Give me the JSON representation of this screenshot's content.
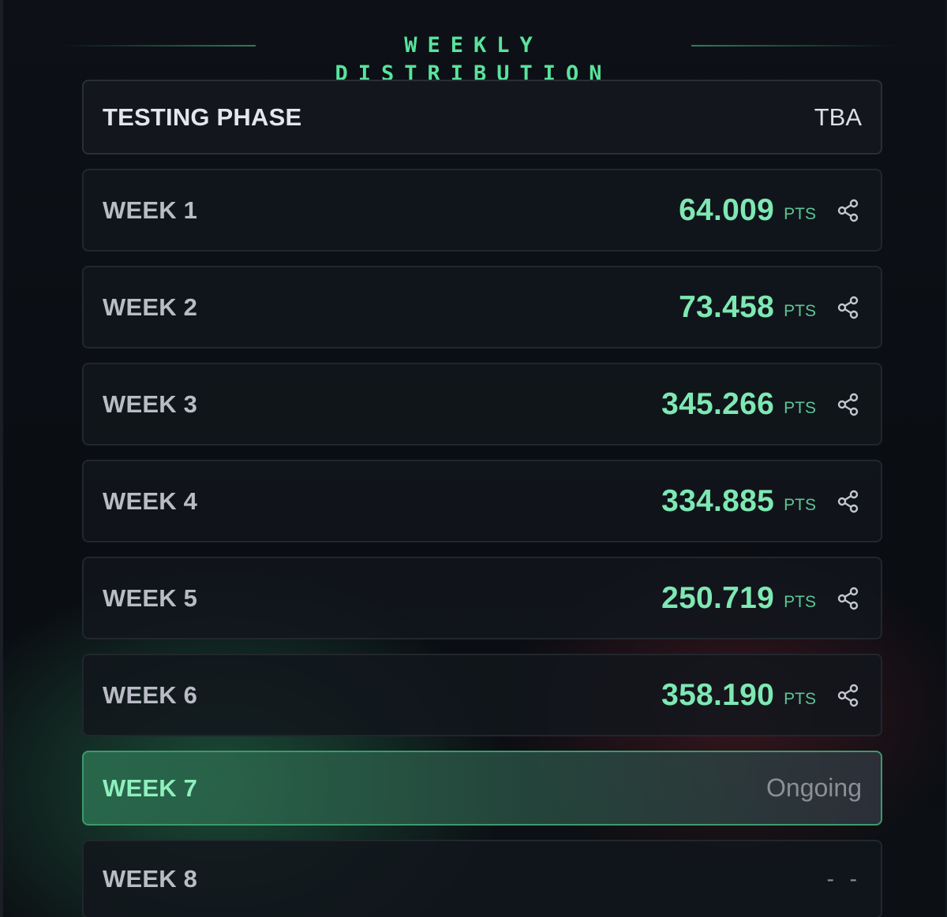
{
  "header": {
    "title": "WEEKLY DISTRIBUTION"
  },
  "testing_phase": {
    "label": "TESTING PHASE",
    "status": "TBA"
  },
  "weeks": [
    {
      "label": "WEEK 1",
      "value": "64.009",
      "unit": "PTS"
    },
    {
      "label": "WEEK 2",
      "value": "73.458",
      "unit": "PTS"
    },
    {
      "label": "WEEK 3",
      "value": "345.266",
      "unit": "PTS"
    },
    {
      "label": "WEEK 4",
      "value": "334.885",
      "unit": "PTS"
    },
    {
      "label": "WEEK 5",
      "value": "250.719",
      "unit": "PTS"
    },
    {
      "label": "WEEK 6",
      "value": "358.190",
      "unit": "PTS"
    }
  ],
  "current_week": {
    "label": "WEEK 7",
    "status": "Ongoing"
  },
  "next_week": {
    "label": "WEEK 8",
    "status": "- -"
  },
  "icons": {
    "share": "share-icon"
  },
  "colors": {
    "accent": "#59e39c",
    "value": "#7ee8b3",
    "active_border": "#3c9a6c"
  }
}
